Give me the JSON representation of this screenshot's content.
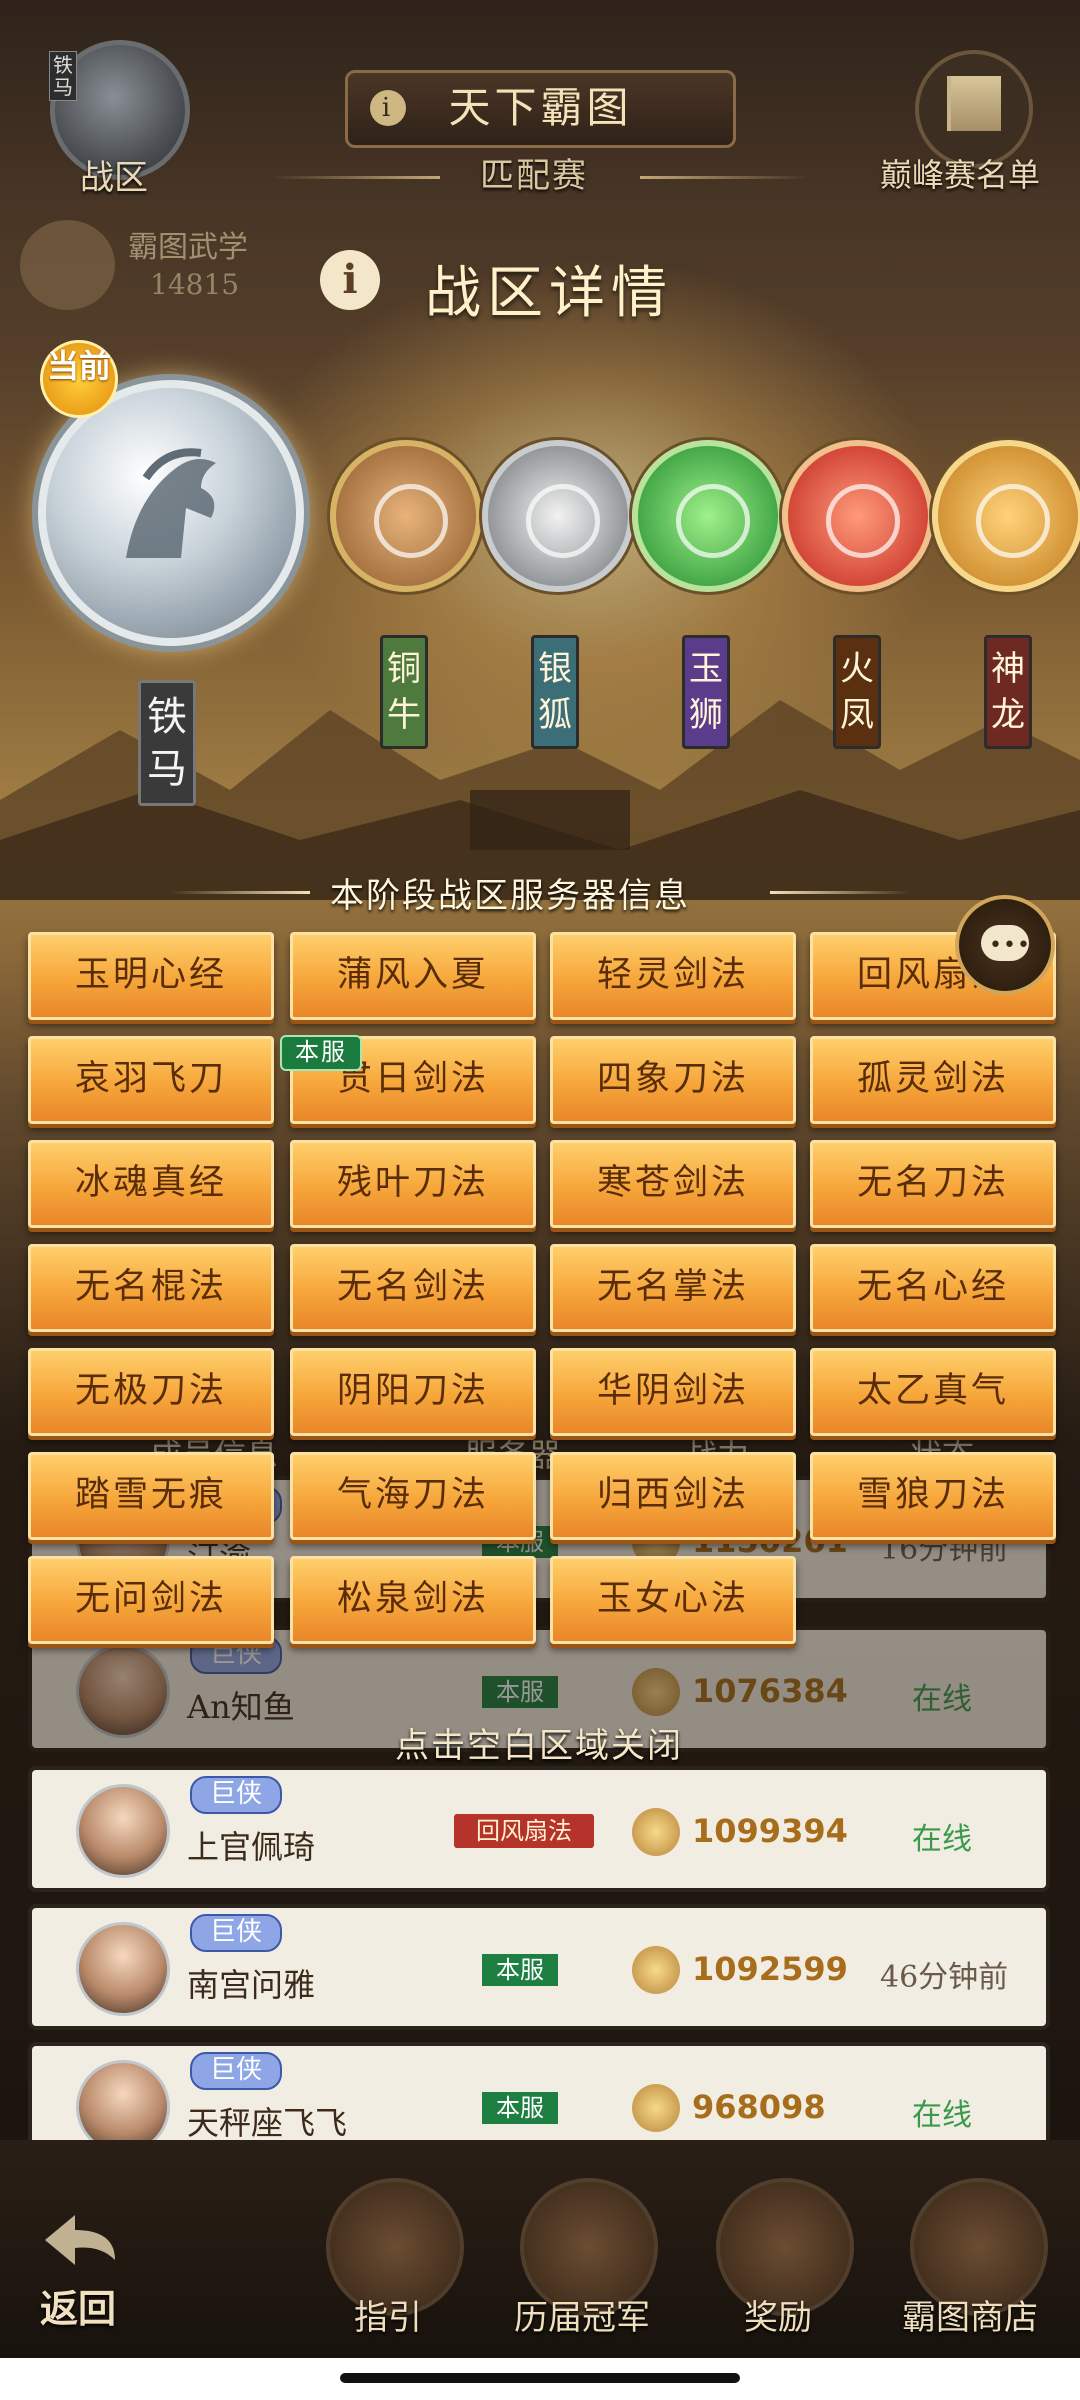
{
  "top": {
    "left_badge_tag": "铁马",
    "left_label": "战区",
    "title": "天下霸图",
    "title_icon": "i",
    "subtitle": "匹配赛",
    "right_label": "巅峰赛名单",
    "wuxue_label": "霸图武学",
    "wuxue_value": "14815"
  },
  "panel": {
    "info_icon": "i",
    "title": "战区详情",
    "current_tag": "当前",
    "current_zone": "铁马",
    "zones": [
      {
        "name": "铜牛",
        "color": "#4e7a3e"
      },
      {
        "name": "银狐",
        "color": "#3c6e78"
      },
      {
        "name": "玉狮",
        "color": "#5a3c8a"
      },
      {
        "name": "火凤",
        "color": "#5a3010"
      },
      {
        "name": "神龙",
        "color": "#6e2a22"
      }
    ],
    "server_info_title": "本阶段战区服务器信息",
    "own_server_tag": "本服",
    "servers": [
      "玉明心经",
      "蒲风入夏",
      "轻灵剑法",
      "回风扇法",
      "哀羽飞刀",
      "贯日剑法",
      "四象刀法",
      "孤灵剑法",
      "冰魂真经",
      "残叶刀法",
      "寒苍剑法",
      "无名刀法",
      "无名棍法",
      "无名剑法",
      "无名掌法",
      "无名心经",
      "无极刀法",
      "阴阳刀法",
      "华阴剑法",
      "太乙真气",
      "踏雪无痕",
      "气海刀法",
      "归西剑法",
      "雪狼刀法",
      "无问剑法",
      "松泉剑法",
      "玉女心法"
    ],
    "close_hint": "点击空白区域关闭"
  },
  "table": {
    "headers": [
      "成员信息",
      "服务器",
      "战力",
      "状态"
    ],
    "rows": [
      {
        "rank": "巨侠",
        "name": "汀渝",
        "server": "本服",
        "power": "1150261",
        "status": "16分钟前"
      },
      {
        "rank": "巨侠",
        "name": "An知鱼",
        "server": "本服",
        "power": "1076384",
        "status": "在线"
      },
      {
        "rank": "巨侠",
        "name": "上官佩琦",
        "server": "回风扇法",
        "power": "1099394",
        "status": "在线"
      },
      {
        "rank": "巨侠",
        "name": "南宫问雅",
        "server": "本服",
        "power": "1092599",
        "status": "46分钟前"
      },
      {
        "rank": "巨侠",
        "name": "天秤座飞飞",
        "server": "本服",
        "power": "968098",
        "status": "在线"
      }
    ]
  },
  "bottom": {
    "back": "返回",
    "nav": [
      "指引",
      "历届冠军",
      "奖励",
      "霸图商店"
    ]
  },
  "icons": [
    "horse-icon",
    "ox-icon",
    "fox-icon",
    "lion-icon",
    "phoenix-icon",
    "dragon-icon",
    "chat-icon",
    "sword-icon",
    "back-arrow-icon",
    "bag-icon",
    "trophy-icon",
    "chest-icon",
    "shop-icon",
    "flag-icon",
    "info-icon"
  ]
}
